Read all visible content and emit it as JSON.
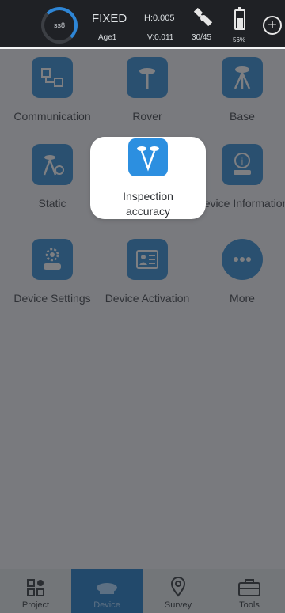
{
  "status": {
    "ring_text": "ss8",
    "fix": "FIXED",
    "age": "Age1",
    "h": "H:0.005",
    "v": "V:0.011",
    "satellites": "30/45",
    "battery": "56%",
    "battery_level": 0.56,
    "plus": "+"
  },
  "tiles": [
    {
      "label": "Communication",
      "icon": "communication-icon"
    },
    {
      "label": "Rover",
      "icon": "rover-icon"
    },
    {
      "label": "Base",
      "icon": "base-icon"
    },
    {
      "label": "Static",
      "icon": "static-icon"
    },
    {
      "label": "Inspection accuracy",
      "icon": "inspection-accuracy-icon"
    },
    {
      "label": "Device Information",
      "icon": "device-information-icon"
    },
    {
      "label": "Device Settings",
      "icon": "device-settings-icon"
    },
    {
      "label": "Device Activation",
      "icon": "device-activation-icon"
    },
    {
      "label": "More",
      "icon": "more-icon"
    }
  ],
  "nav": [
    {
      "label": "Project",
      "icon": "project-icon",
      "active": false
    },
    {
      "label": "Device",
      "icon": "device-icon",
      "active": true
    },
    {
      "label": "Survey",
      "icon": "survey-pin-icon",
      "active": false
    },
    {
      "label": "Tools",
      "icon": "toolbox-icon",
      "active": false
    }
  ],
  "colors": {
    "accent": "#2f8ad1",
    "status_bg": "#1f2125",
    "nav_active": "#1c6fb5"
  }
}
